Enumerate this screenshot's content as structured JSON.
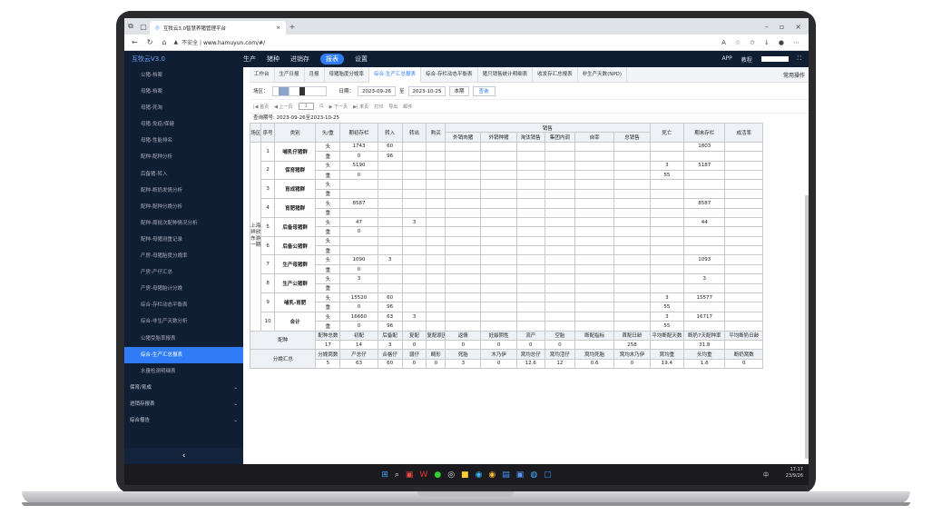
{
  "browser": {
    "tab_title": "互牧云3.0智慧养猪管理平台",
    "url_warning": "不安全",
    "url": "www.hamuyun.com/#/"
  },
  "app": {
    "logo": "互牧云V3.0",
    "menu": [
      "生产",
      "猪种",
      "进销存",
      "报表",
      "设置"
    ],
    "active_menu": "报表",
    "right": [
      "APP",
      "教程"
    ]
  },
  "sidebar": {
    "items": [
      "公猪-档案",
      "母猪-档案",
      "母猪-死淘",
      "母猪-免疫/保健",
      "母猪-性能排名",
      "配种-配种分析",
      "后备猪-转入",
      "配种-断奶发情分析",
      "配种-配种分娩分析",
      "配种-周批次配种情况分析",
      "配种-母猪测重记录",
      "产房-母猪胎度分娩率",
      "产房-产仔汇总",
      "产房-母猪胎计分娩",
      "综合-存栏动态平衡表",
      "综合-非生产天数分析",
      "公猪受胎率报表",
      "综合-生产汇总报表",
      "水量检测明细表"
    ],
    "active": "综合-生产汇总报表",
    "groups": [
      "保育/育成",
      "进销存报表",
      "综合报告"
    ]
  },
  "page_tabs": [
    "工作台",
    "生产日报",
    "月报",
    "母猪胎度分娩率",
    "综合-生产汇总报表",
    "综合-存栏动态平衡表",
    "猪只销售统计明细表",
    "收发存汇总报表",
    "非生产天数(NPD)"
  ],
  "active_tab": "综合-生产汇总报表",
  "tab_ops": "常用操作",
  "filter": {
    "area_label": "场区：",
    "date_label": "日期：",
    "date_from": "2023-09-26",
    "to": "至",
    "date_to": "2023-10-25",
    "period": "本期",
    "query": "查询"
  },
  "toolbar": [
    "|◀ 首页",
    "◀ 上一页",
    "1",
    "/1",
    "▶ 下一页",
    "▶| 末页",
    "打印",
    "导出",
    "邮件"
  ],
  "query_range": "查询期号: 2023-09-26至2023-10-25",
  "table": {
    "h": [
      "场区",
      "序号",
      "类别",
      "头/重",
      "期初存栏",
      "转入",
      "转出",
      "购买",
      "销售",
      "死亡",
      "期末存栏",
      "成活率"
    ],
    "sales_sub": [
      "外销肉猪",
      "外销种猪",
      "淘汰销售",
      "集团内调",
      "自宰",
      "总销售"
    ],
    "farm": "上海祥欣东游一期",
    "groups": [
      {
        "no": "1",
        "name": "哺乳仔猪群",
        "rows": [
          [
            "头",
            "1743",
            "60",
            "",
            "",
            "",
            "",
            "",
            "",
            "",
            "",
            "",
            "1803",
            ""
          ],
          [
            "重",
            "0",
            "96",
            "",
            "",
            "",
            "",
            "",
            "",
            "",
            "",
            "",
            "",
            ""
          ]
        ]
      },
      {
        "no": "2",
        "name": "保育猪群",
        "rows": [
          [
            "头",
            "5190",
            "",
            "",
            "",
            "",
            "",
            "",
            "",
            "",
            "",
            "3",
            "5187",
            ""
          ],
          [
            "重",
            "0",
            "",
            "",
            "",
            "",
            "",
            "",
            "",
            "",
            "",
            "55",
            "",
            ""
          ]
        ]
      },
      {
        "no": "3",
        "name": "育成猪群",
        "rows": [
          [
            "头",
            "",
            "",
            "",
            "",
            "",
            "",
            "",
            "",
            "",
            "",
            "",
            "",
            ""
          ],
          [
            "重",
            "",
            "",
            "",
            "",
            "",
            "",
            "",
            "",
            "",
            "",
            "",
            "",
            ""
          ]
        ]
      },
      {
        "no": "4",
        "name": "育肥猪群",
        "rows": [
          [
            "头",
            "8587",
            "",
            "",
            "",
            "",
            "",
            "",
            "",
            "",
            "",
            "",
            "8587",
            ""
          ],
          [
            "重",
            "",
            "",
            "",
            "",
            "",
            "",
            "",
            "",
            "",
            "",
            "",
            "",
            ""
          ]
        ]
      },
      {
        "no": "5",
        "name": "后备母猪群",
        "rows": [
          [
            "头",
            "47",
            "",
            "3",
            "",
            "",
            "",
            "",
            "",
            "",
            "",
            "",
            "44",
            ""
          ],
          [
            "重",
            "0",
            "",
            "",
            "",
            "",
            "",
            "",
            "",
            "",
            "",
            "",
            "",
            ""
          ]
        ]
      },
      {
        "no": "6",
        "name": "后备公猪群",
        "rows": [
          [
            "头",
            "",
            "",
            "",
            "",
            "",
            "",
            "",
            "",
            "",
            "",
            "",
            "",
            ""
          ],
          [
            "重",
            "",
            "",
            "",
            "",
            "",
            "",
            "",
            "",
            "",
            "",
            "",
            "",
            ""
          ]
        ]
      },
      {
        "no": "7",
        "name": "生产母猪群",
        "rows": [
          [
            "头",
            "1090",
            "3",
            "",
            "",
            "",
            "",
            "",
            "",
            "",
            "",
            "",
            "1093",
            ""
          ],
          [
            "重",
            "0",
            "",
            "",
            "",
            "",
            "",
            "",
            "",
            "",
            "",
            "",
            "",
            ""
          ]
        ]
      },
      {
        "no": "8",
        "name": "生产公猪群",
        "rows": [
          [
            "头",
            "3",
            "",
            "",
            "",
            "",
            "",
            "",
            "",
            "",
            "",
            "",
            "3",
            ""
          ],
          [
            "重",
            "",
            "",
            "",
            "",
            "",
            "",
            "",
            "",
            "",
            "",
            "",
            "",
            ""
          ]
        ]
      },
      {
        "no": "9",
        "name": "哺乳-育肥",
        "rows": [
          [
            "头",
            "15520",
            "60",
            "",
            "",
            "",
            "",
            "",
            "",
            "",
            "",
            "3",
            "15577",
            ""
          ],
          [
            "重",
            "0",
            "96",
            "",
            "",
            "",
            "",
            "",
            "",
            "",
            "",
            "55",
            "",
            ""
          ]
        ]
      },
      {
        "no": "10",
        "name": "合计",
        "rows": [
          [
            "头",
            "16660",
            "63",
            "3",
            "",
            "",
            "",
            "",
            "",
            "",
            "",
            "3",
            "16717",
            ""
          ],
          [
            "重",
            "0",
            "96",
            "",
            "",
            "",
            "",
            "",
            "",
            "",
            "",
            "55",
            "",
            ""
          ]
        ]
      }
    ],
    "mating": {
      "label": "配种",
      "h": [
        "配种总数",
        "初配",
        "后备配",
        "复配",
        "复配原因",
        "返情",
        "妊娠阴性",
        "流产",
        "空胎",
        "断配指标",
        "首配日龄",
        "平均断配天数",
        "断奶7天配种率",
        "平均断奶日龄"
      ],
      "v": [
        "17",
        "14",
        "3",
        "0",
        "",
        "0",
        "0",
        "0",
        "0",
        "",
        "258",
        "",
        "31.8",
        ""
      ]
    },
    "farrow": {
      "label": "分娩汇总",
      "h": [
        "分娩窝数",
        "产总仔",
        "合格仔",
        "弱仔",
        "畸形",
        "死胎",
        "木乃伊",
        "窝均总仔",
        "窝均活仔",
        "窝均死胎",
        "窝均木乃伊",
        "窝均重",
        "头均重",
        "断奶窝数"
      ],
      "v": [
        "5",
        "63",
        "60",
        "0",
        "0",
        "3",
        "0",
        "12.6",
        "12",
        "0.6",
        "0",
        "19.4",
        "1.6",
        "0"
      ]
    }
  },
  "taskbar": {
    "ime": "中",
    "time": "17:17",
    "date": "23/9/26"
  }
}
